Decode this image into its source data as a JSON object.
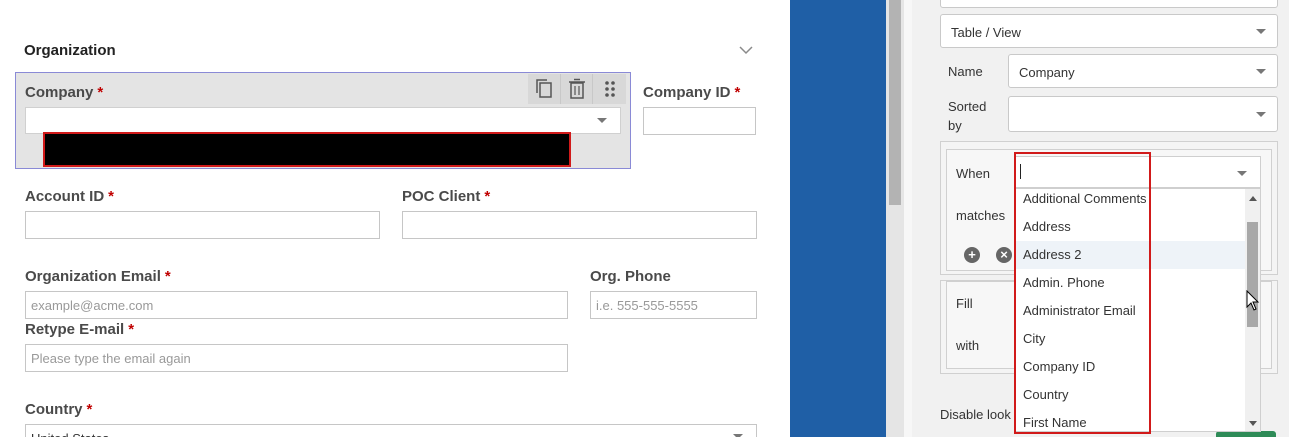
{
  "form": {
    "section_title": "Organization",
    "company": {
      "label": "Company",
      "value": ""
    },
    "company_id": {
      "label": "Company ID",
      "value": ""
    },
    "account_id": {
      "label": "Account ID",
      "value": ""
    },
    "poc_client": {
      "label": "POC Client",
      "value": ""
    },
    "org_email": {
      "label": "Organization Email",
      "placeholder": "example@acme.com"
    },
    "org_phone": {
      "label": "Org. Phone",
      "placeholder": "i.e. 555-555-5555"
    },
    "retype_email": {
      "label": "Retype E-mail",
      "placeholder": "Please type the email again"
    },
    "country": {
      "label": "Country",
      "value": "United States"
    },
    "required_marker": "*"
  },
  "properties": {
    "table_view": "Table / View",
    "name_label": "Name",
    "name_value": "Company",
    "sorted_by_label": "Sorted by",
    "sorted_line1": "Sorted",
    "sorted_line2": "by",
    "when_label": "When",
    "matches_label": "matches",
    "fill_label": "Fill",
    "with_label": "with",
    "disable_label": "Disable look"
  },
  "dropdown": {
    "value": "",
    "items": [
      "Additional Comments",
      "Address",
      "Address 2",
      "Admin. Phone",
      "Administrator Email",
      "City",
      "Company ID",
      "Country",
      "First Name"
    ],
    "highlighted": "Address 2"
  },
  "colors": {
    "required": "#c00000",
    "accent_blue": "#1f5fa6",
    "highlight_outline": "#d11a1a"
  }
}
